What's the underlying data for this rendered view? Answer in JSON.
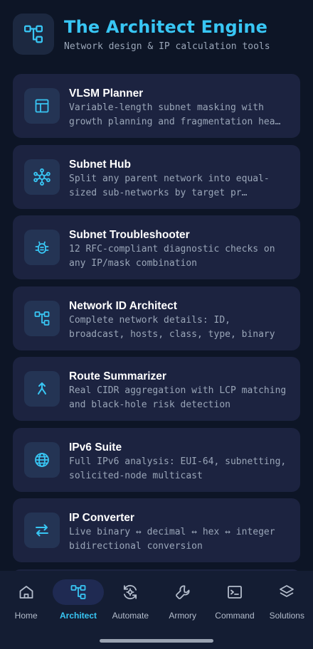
{
  "header": {
    "title": "The Architect Engine",
    "subtitle": "Network design & IP calculation tools",
    "icon": "network-diagram-icon"
  },
  "colors": {
    "accent": "#38c6f4",
    "background": "#0d1526",
    "card": "#1c2340",
    "icon_tile": "#243454",
    "nav_bg": "#141d33",
    "active_pill": "#1f2a52"
  },
  "tools": [
    {
      "title": "VLSM Planner",
      "description": "Variable-length subnet masking with growth planning and fragmentation hea…",
      "icon": "layout-icon"
    },
    {
      "title": "Subnet Hub",
      "description": "Split any parent network into equal-sized sub-networks by target pr…",
      "icon": "hub-icon"
    },
    {
      "title": "Subnet Troubleshooter",
      "description": "12 RFC-compliant diagnostic checks on any IP/mask combination",
      "icon": "bug-icon"
    },
    {
      "title": "Network ID Architect",
      "description": "Complete network details: ID, broadcast, hosts, class, type, binary",
      "icon": "network-diagram-icon"
    },
    {
      "title": "Route Summarizer",
      "description": "Real CIDR aggregation with LCP matching and black-hole risk detection",
      "icon": "merge-icon"
    },
    {
      "title": "IPv6 Suite",
      "description": "Full IPv6 analysis: EUI-64, subnetting, solicited-node multicast",
      "icon": "globe-icon"
    },
    {
      "title": "IP Converter",
      "description": "Live binary ↔ decimal ↔ hex ↔ integer bidirectional conversion",
      "icon": "swap-arrows-icon"
    }
  ],
  "nav": {
    "items": [
      {
        "label": "Home",
        "icon": "home-icon",
        "active": false
      },
      {
        "label": "Architect",
        "icon": "network-diagram-icon",
        "active": true
      },
      {
        "label": "Automate",
        "icon": "sync-settings-icon",
        "active": false
      },
      {
        "label": "Armory",
        "icon": "wrench-icon",
        "active": false
      },
      {
        "label": "Command",
        "icon": "terminal-icon",
        "active": false
      },
      {
        "label": "Solutions",
        "icon": "layers-icon",
        "active": false
      }
    ]
  }
}
